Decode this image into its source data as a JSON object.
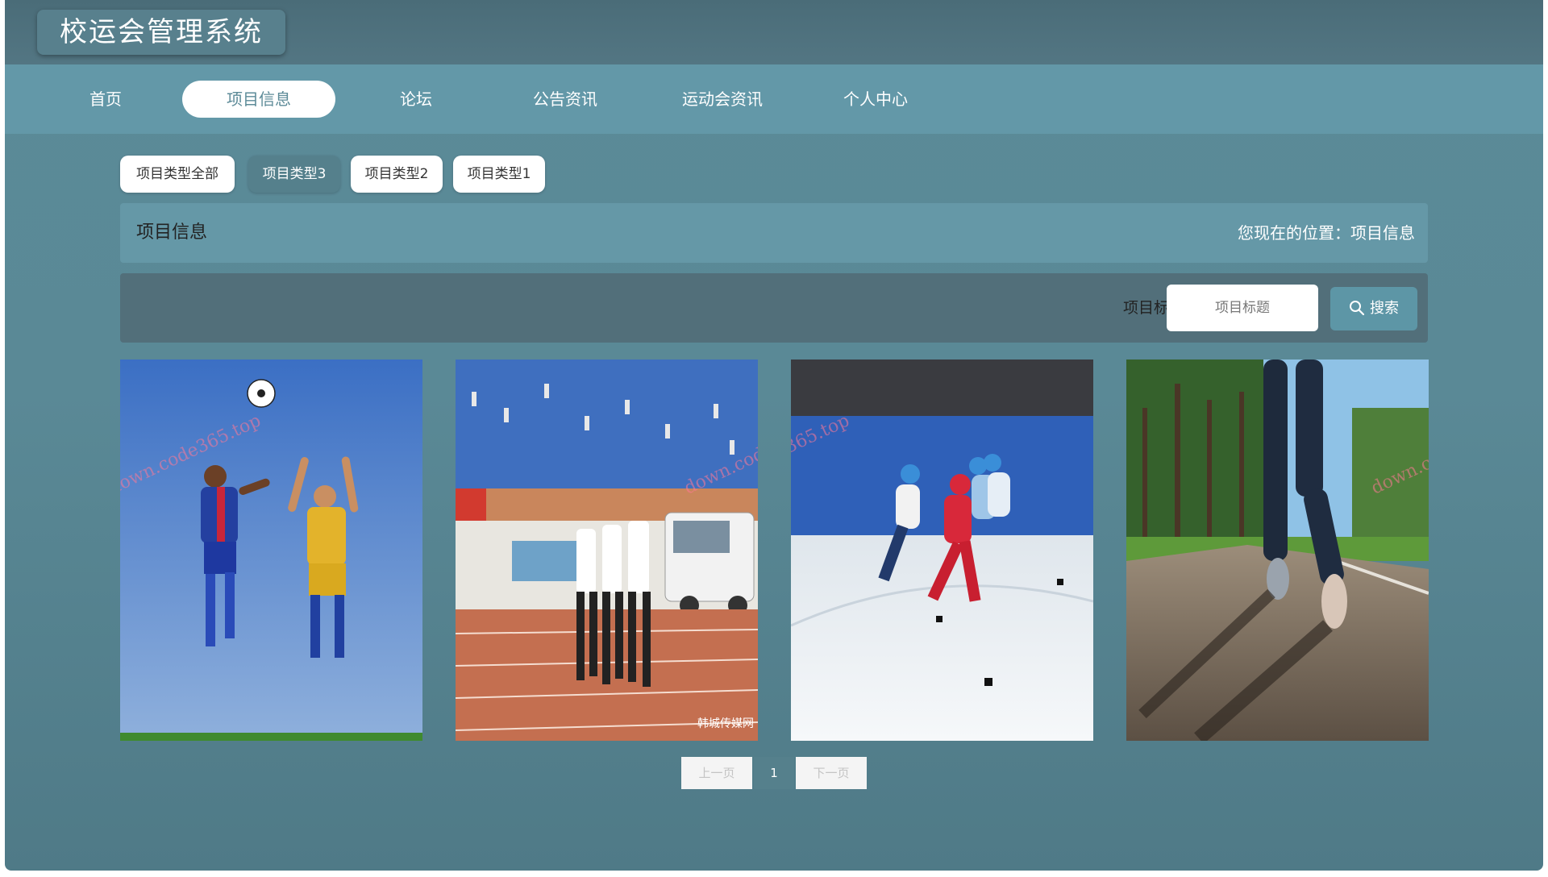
{
  "header": {
    "title": "校运会管理系统"
  },
  "nav": {
    "items": [
      {
        "label": "首页"
      },
      {
        "label": "项目信息"
      },
      {
        "label": "论坛"
      },
      {
        "label": "公告资讯"
      },
      {
        "label": "运动会资讯"
      },
      {
        "label": "个人中心"
      }
    ],
    "active": "项目信息"
  },
  "filters": {
    "items": [
      {
        "label": "项目类型全部"
      },
      {
        "label": "项目类型3"
      },
      {
        "label": "项目类型2"
      },
      {
        "label": "项目类型1"
      }
    ],
    "active": "项目类型3"
  },
  "breadcrumb": {
    "title": "项目信息",
    "location_prefix": "您现在的位置：",
    "location": "项目信息"
  },
  "search": {
    "label": "项目标题",
    "placeholder": "项目标题",
    "value": "",
    "button_label": "搜索",
    "button_icon": "search-icon"
  },
  "cards": [
    {
      "image": "football-players-jumping-header"
    },
    {
      "image": "runners-on-track"
    },
    {
      "image": "speed-skaters-on-ice"
    },
    {
      "image": "jogger-on-road"
    }
  ],
  "card_text": {
    "photo_credit": "韩城传媒网"
  },
  "watermark": "down.code365.top",
  "pagination": {
    "prev_label": "上一页",
    "current": "1",
    "next_label": "下一页"
  },
  "colors": {
    "nav_bg": "#6398a8",
    "topbar_bg": "#4a6c78",
    "active_chip": "#55808c",
    "search_button": "#5d96a6"
  }
}
